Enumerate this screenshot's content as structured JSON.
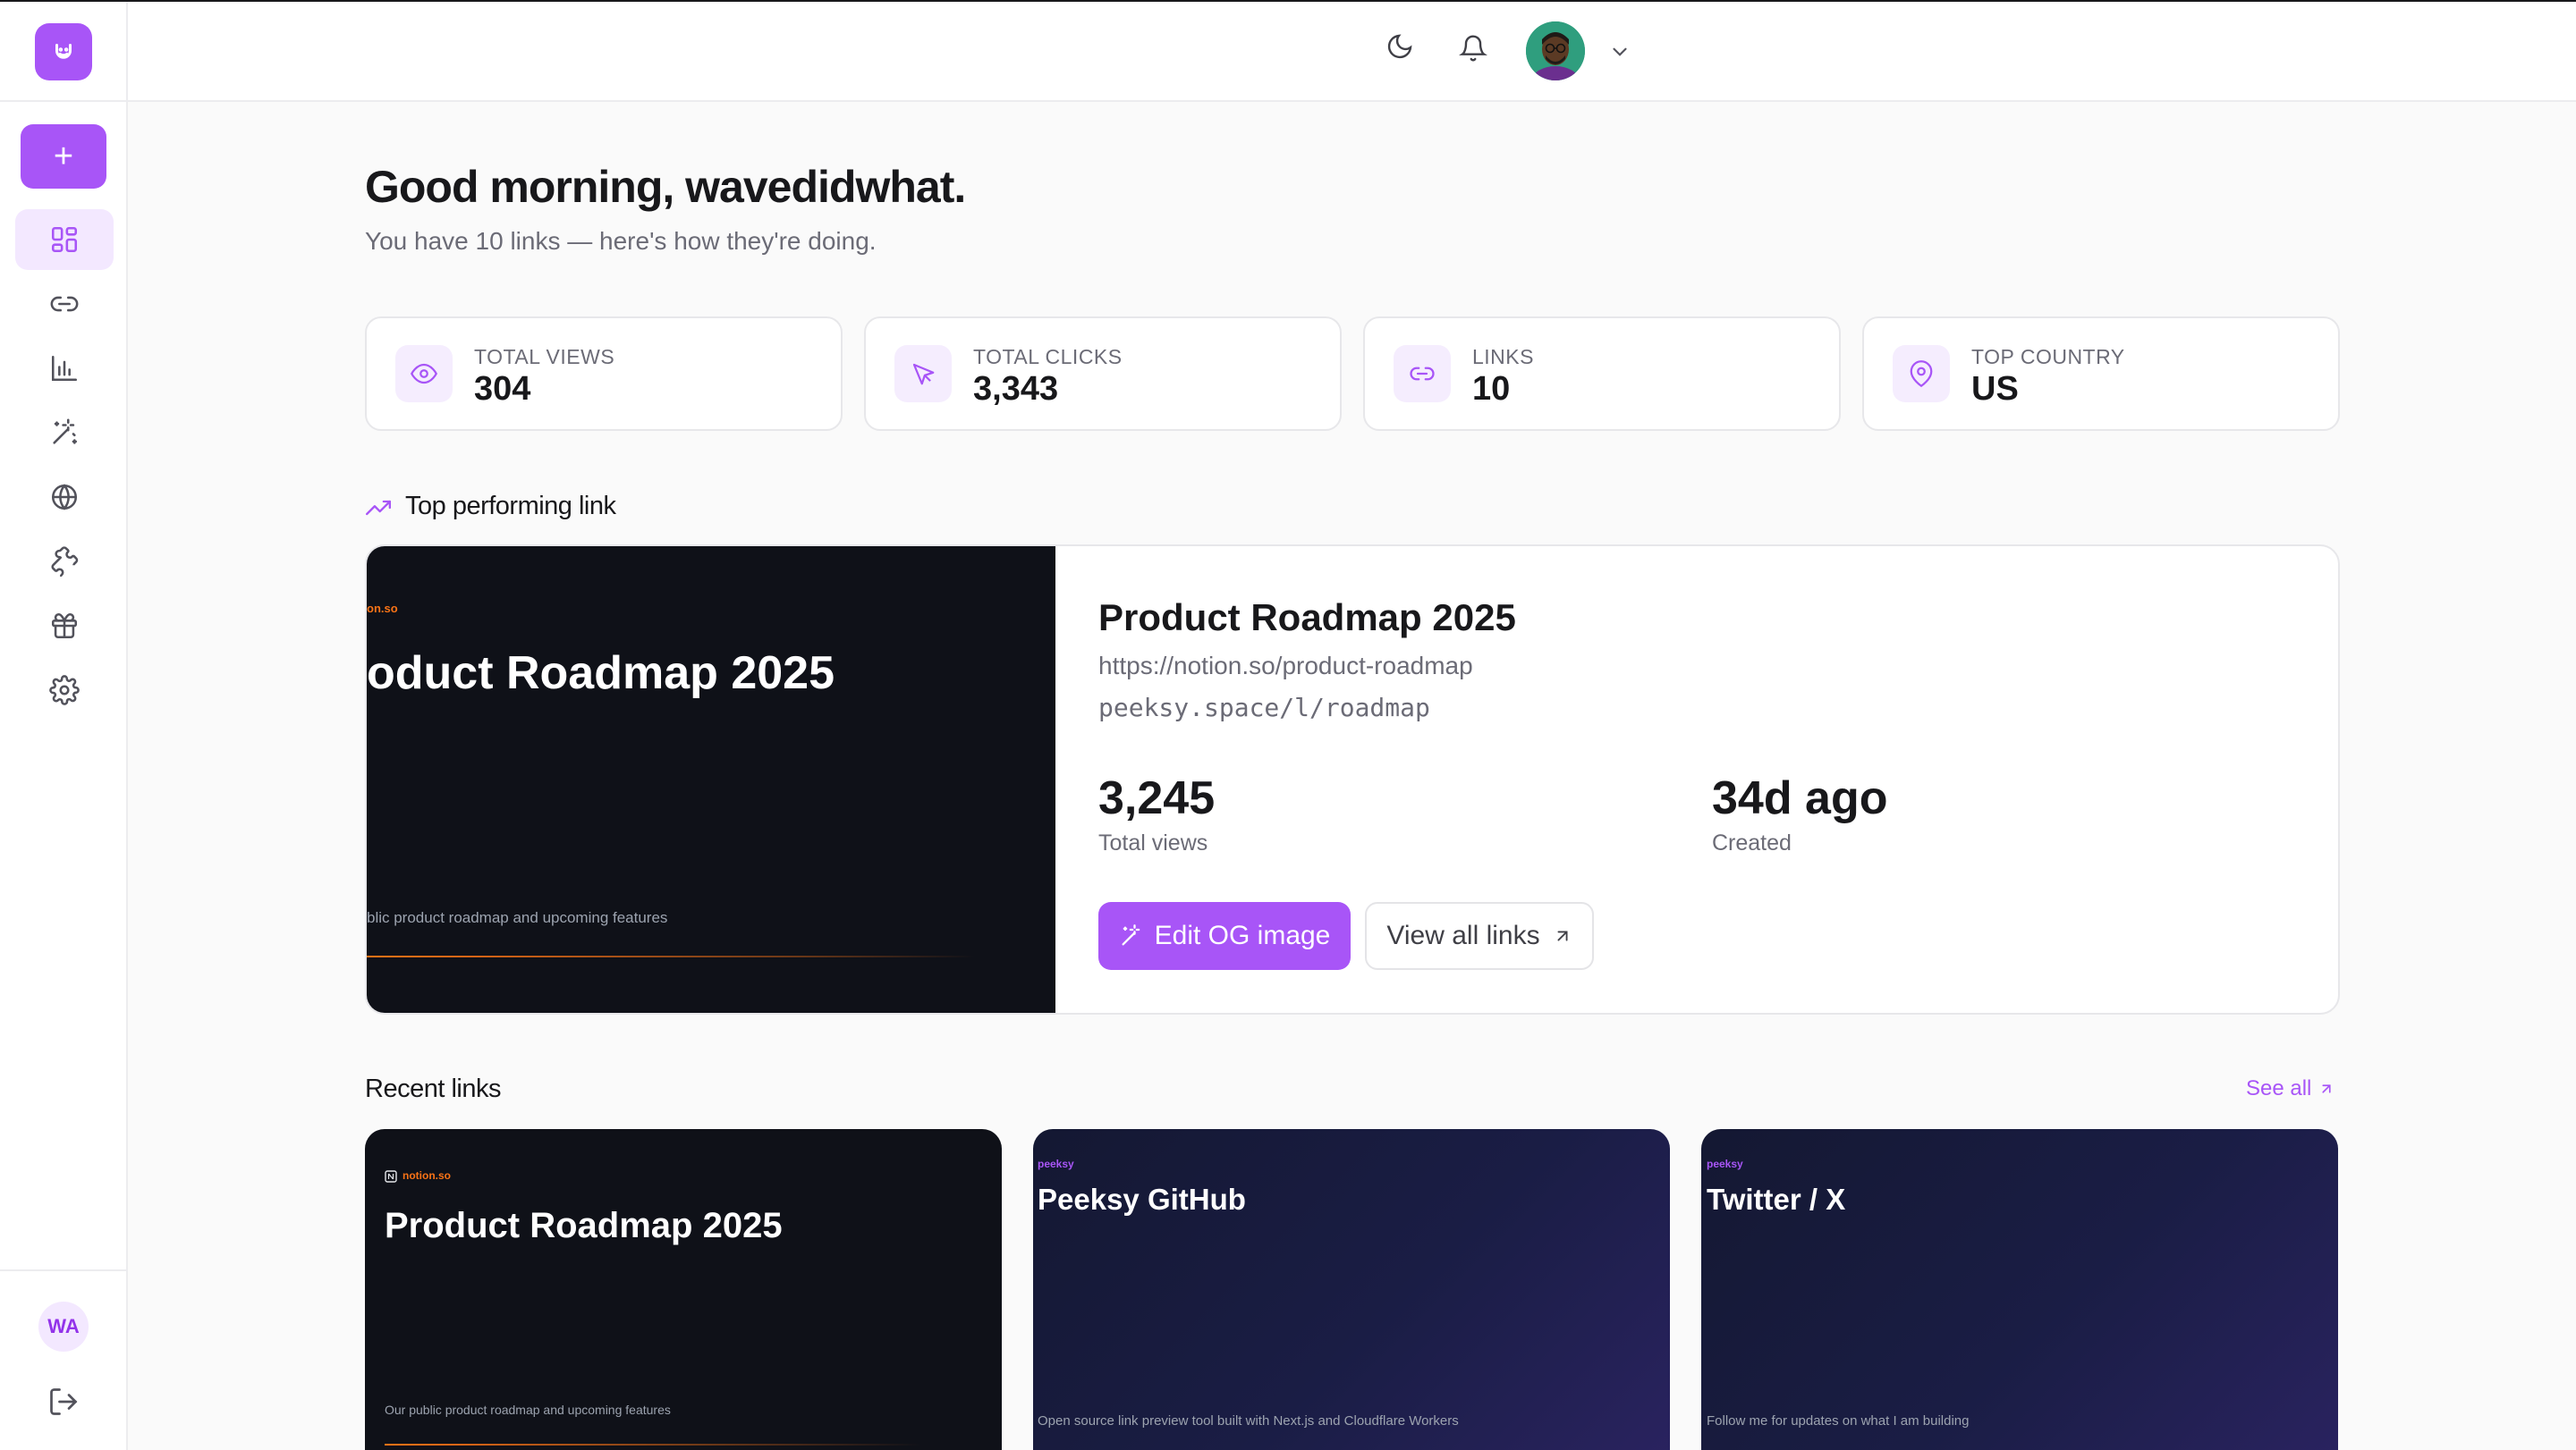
{
  "header": {
    "theme_toggle": "moon-icon",
    "notifications": "bell-icon",
    "user_menu_chevron": "chevron-down-icon"
  },
  "sidebar": {
    "new_button_label": "+",
    "items": [
      {
        "name": "dashboard",
        "icon": "grid-icon",
        "active": true
      },
      {
        "name": "links",
        "icon": "link-icon"
      },
      {
        "name": "analytics",
        "icon": "bar-chart-icon"
      },
      {
        "name": "og-editor",
        "icon": "magic-wand-icon"
      },
      {
        "name": "domains",
        "icon": "globe-icon"
      },
      {
        "name": "integrations",
        "icon": "puzzle-icon"
      },
      {
        "name": "referrals",
        "icon": "gift-icon"
      },
      {
        "name": "settings",
        "icon": "gear-icon"
      }
    ],
    "user_initials": "WA"
  },
  "main": {
    "greeting": "Good morning, wavedidwhat.",
    "subtitle": "You have 10 links — here's how they're doing.",
    "stats": [
      {
        "label": "TOTAL VIEWS",
        "value": "304",
        "icon": "eye-icon"
      },
      {
        "label": "TOTAL CLICKS",
        "value": "3,343",
        "icon": "cursor-icon"
      },
      {
        "label": "LINKS",
        "value": "10",
        "icon": "link-icon"
      },
      {
        "label": "TOP COUNTRY",
        "value": "US",
        "icon": "map-pin-icon"
      }
    ],
    "top_section_title": "Top performing link",
    "top_link": {
      "og_domain": "on.so",
      "og_title": "oduct Roadmap 2025",
      "og_desc": "blic product roadmap and upcoming features",
      "title": "Product Roadmap 2025",
      "url": "https://notion.so/product-roadmap",
      "short": "peeksy.space/l/roadmap",
      "views": "3,245",
      "views_label": "Total views",
      "created": "34d ago",
      "created_label": "Created",
      "edit_label": "Edit OG image",
      "view_all_label": "View all links"
    },
    "recent_title": "Recent links",
    "see_all": "See all",
    "recent": [
      {
        "domain": "notion.so",
        "title": "Product Roadmap 2025",
        "desc": "Our public product roadmap and upcoming features"
      },
      {
        "domain": "peeksy",
        "title": "Peeksy GitHub",
        "desc": "Open source link preview tool built with Next.js and Cloudflare Workers"
      },
      {
        "domain": "peeksy",
        "title": "Twitter / X",
        "desc": "Follow me for updates on what I am building"
      }
    ]
  },
  "colors": {
    "accent": "#a855f7",
    "accent_light": "#f3e8ff",
    "og_orange": "#f97316",
    "og_dark": "#0f1118"
  }
}
